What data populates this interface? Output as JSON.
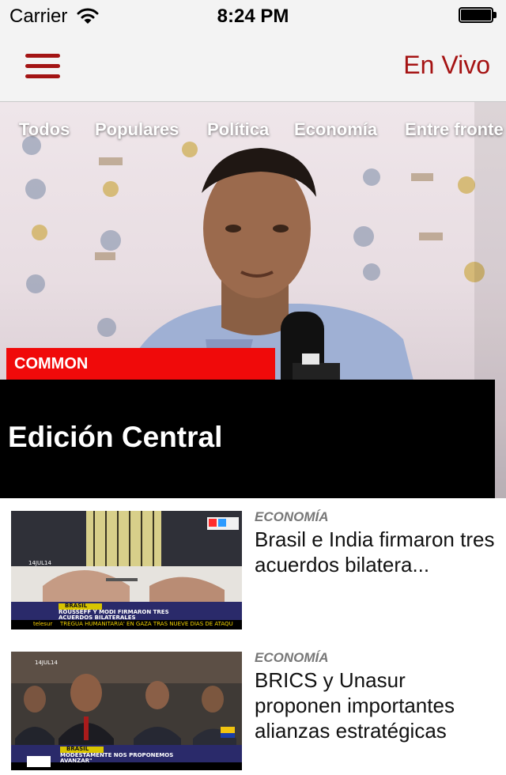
{
  "status_bar": {
    "carrier": "Carrier",
    "time": "8:24 PM"
  },
  "nav": {
    "live_label": "En Vivo"
  },
  "categories": [
    "Todos",
    "Populares",
    "Política",
    "Economía",
    "Entre fronte"
  ],
  "featured": {
    "badge": "COMMON",
    "title": "Edición Central"
  },
  "news": [
    {
      "category": "ECONOMÍA",
      "title": "Brasil e India firmaron tres acuerdos bilatera...",
      "thumb": {
        "date": "14JUL14",
        "tag": "BRASIL",
        "headline": "ROUSSEFF Y MODI FIRMARON TRES ACUERDOS BILATERALES",
        "ticker": "TREGUA HUMANITARIA' EN GAZA TRAS NUEVE DÍAS DE ATAQU",
        "brand": "telesur"
      }
    },
    {
      "category": "ECONOMÍA",
      "title": "BRICS y Unasur proponen importantes alianzas estratégicas",
      "thumb": {
        "date": "14JUL14",
        "tag": "BRASIL",
        "headline": "MODESTAMENTE NOS PROPONEMOS AVANZAR\""
      }
    }
  ],
  "colors": {
    "accent": "#a51313",
    "badge": "#f00a0a",
    "caption_bg": "#000000"
  }
}
